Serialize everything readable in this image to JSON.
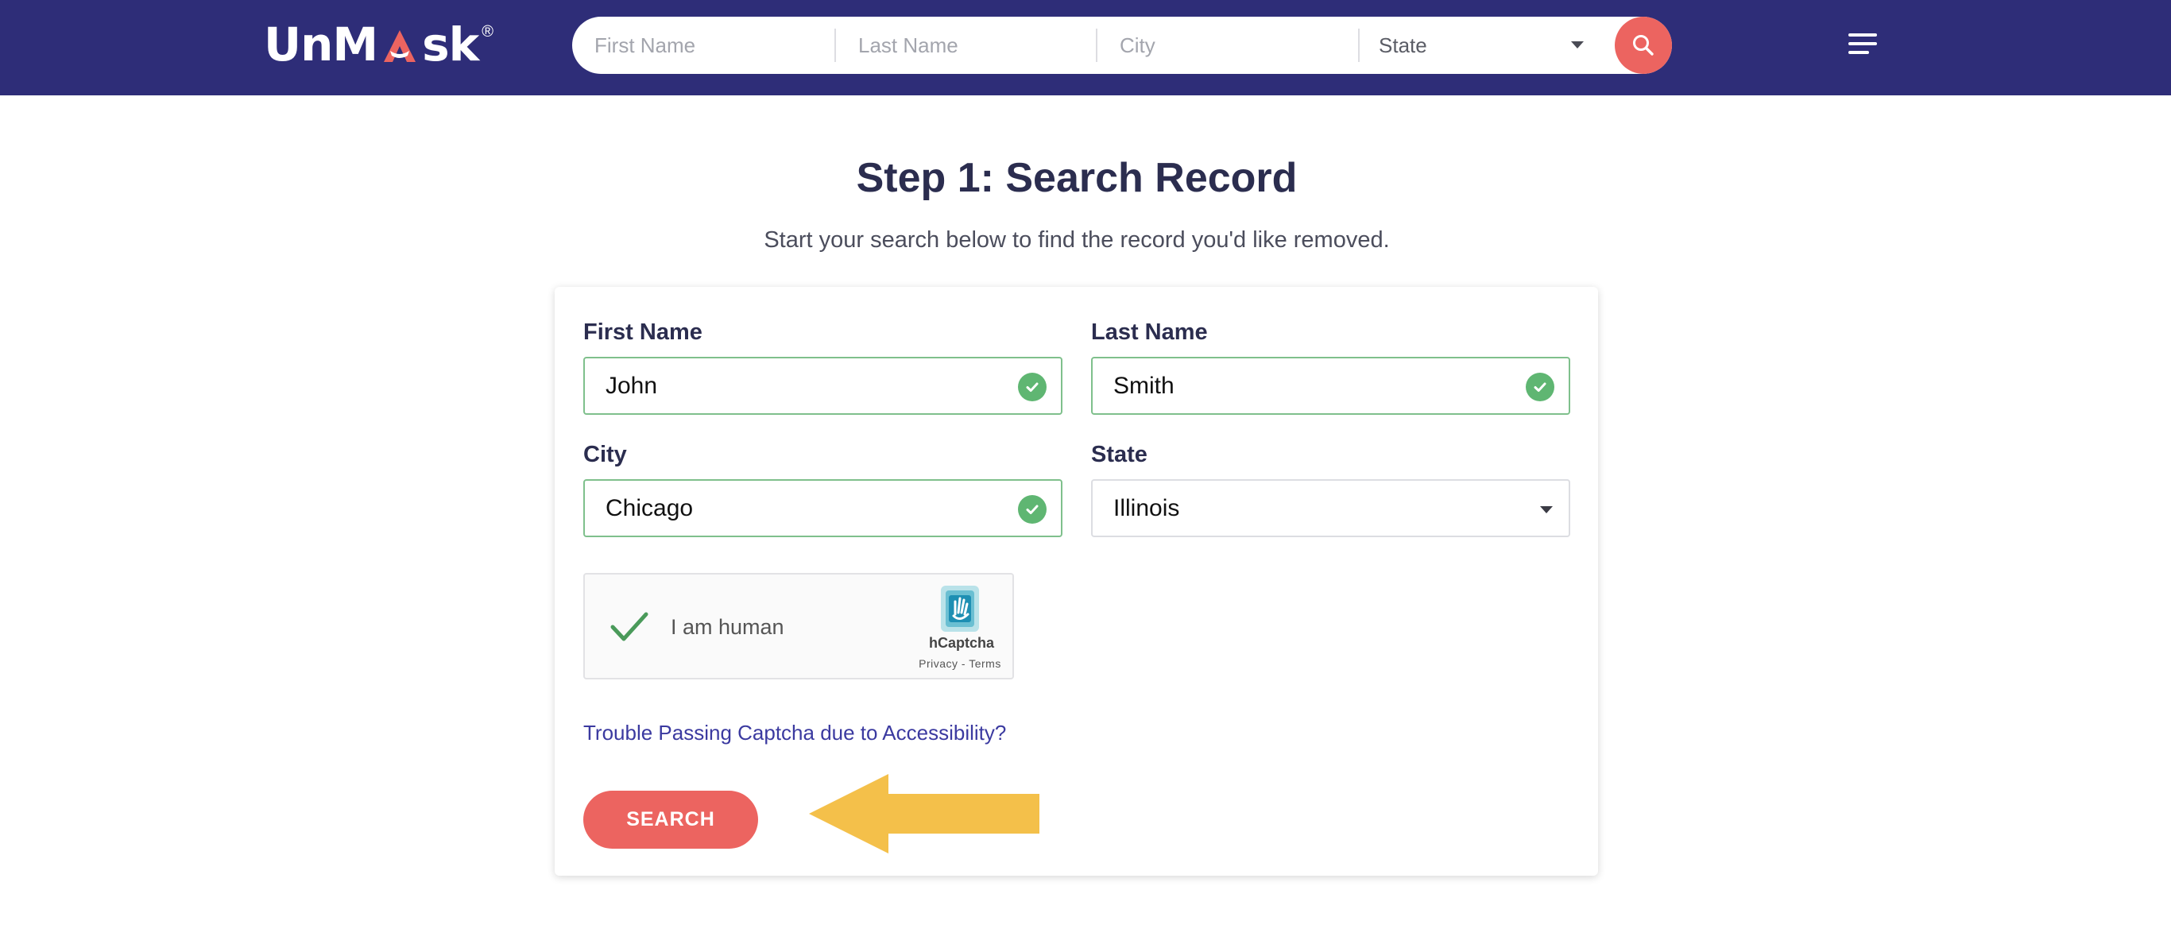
{
  "header": {
    "logo_text_1": "UnM",
    "logo_text_2": "sk",
    "logo_reg": "®",
    "search": {
      "first_name_placeholder": "First Name",
      "last_name_placeholder": "Last Name",
      "city_placeholder": "City",
      "state_label": "State"
    },
    "icons": {
      "search": "search-icon",
      "menu": "hamburger-menu-icon"
    }
  },
  "main": {
    "title": "Step 1: Search Record",
    "subtitle": "Start your search below to find the record you'd like removed.",
    "form": {
      "first_name": {
        "label": "First Name",
        "value": "John",
        "valid": true
      },
      "last_name": {
        "label": "Last Name",
        "value": "Smith",
        "valid": true
      },
      "city": {
        "label": "City",
        "value": "Chicago",
        "valid": true
      },
      "state": {
        "label": "State",
        "value": "Illinois"
      }
    },
    "captcha": {
      "label": "I am human",
      "brand": "hCaptcha",
      "links": "Privacy - Terms",
      "checked": true
    },
    "accessibility_link": "Trouble Passing Captcha due to Accessibility?",
    "search_button": "SEARCH"
  },
  "colors": {
    "header_bg": "#2e2d78",
    "accent": "#ec6460",
    "valid_green": "#5fb672",
    "link": "#3b3aa0",
    "arrow": "#f4c04a"
  }
}
